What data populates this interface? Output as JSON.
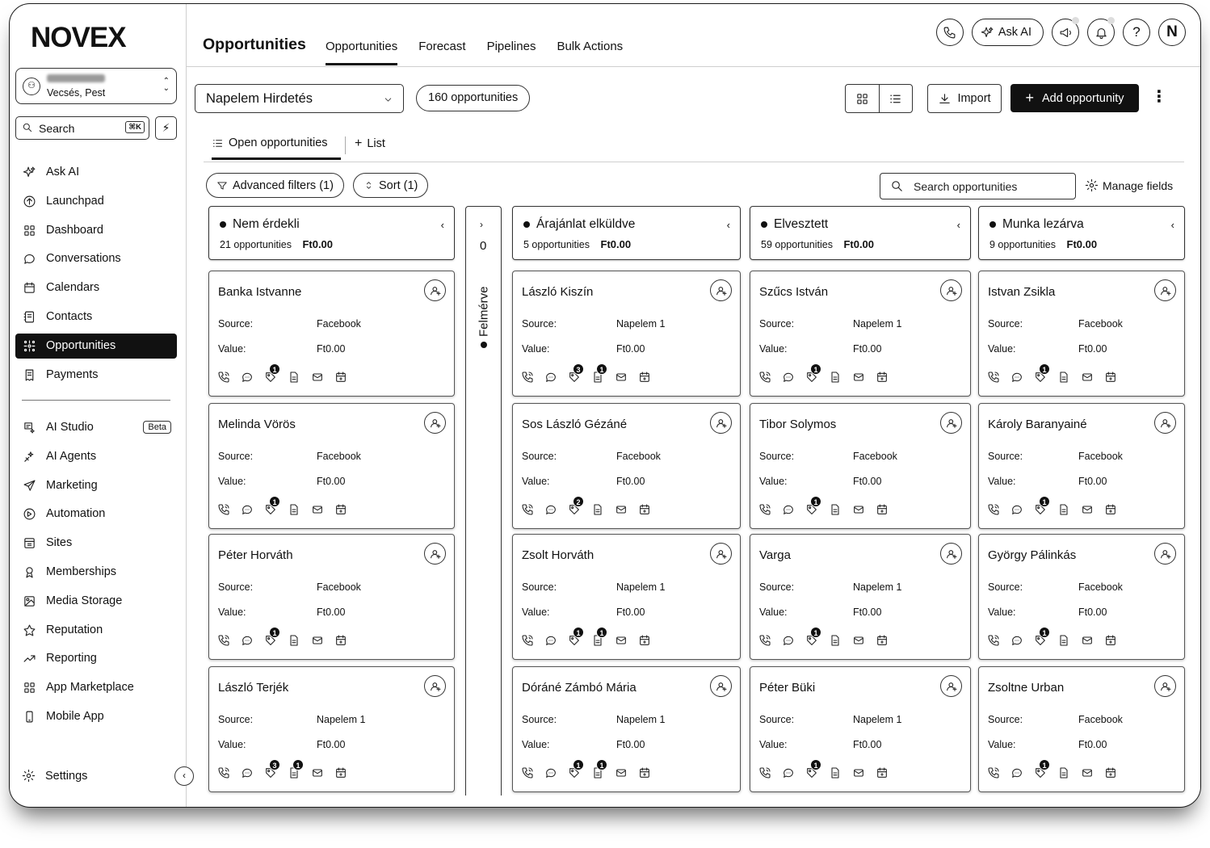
{
  "brand": "NOVEX",
  "location": {
    "city": "Vecsés, Pest"
  },
  "search": {
    "label": "Search",
    "shortcut": "⌘K"
  },
  "nav": [
    {
      "label": "Ask AI",
      "icon": "sparkle-icon"
    },
    {
      "label": "Launchpad",
      "icon": "launchpad-icon"
    },
    {
      "label": "Dashboard",
      "icon": "dashboard-icon"
    },
    {
      "label": "Conversations",
      "icon": "chat-icon"
    },
    {
      "label": "Calendars",
      "icon": "calendar-icon"
    },
    {
      "label": "Contacts",
      "icon": "contacts-icon"
    },
    {
      "label": "Opportunities",
      "icon": "opportunities-icon",
      "active": true
    },
    {
      "label": "Payments",
      "icon": "payments-icon"
    }
  ],
  "nav2": [
    {
      "label": "AI Studio",
      "icon": "ai-studio-icon",
      "badge": "Beta"
    },
    {
      "label": "AI Agents",
      "icon": "ai-agents-icon"
    },
    {
      "label": "Marketing",
      "icon": "send-icon"
    },
    {
      "label": "Automation",
      "icon": "automation-icon"
    },
    {
      "label": "Sites",
      "icon": "sites-icon"
    },
    {
      "label": "Memberships",
      "icon": "membership-icon"
    },
    {
      "label": "Media Storage",
      "icon": "image-icon"
    },
    {
      "label": "Reputation",
      "icon": "star-icon"
    },
    {
      "label": "Reporting",
      "icon": "trend-icon"
    },
    {
      "label": "App Marketplace",
      "icon": "grid-icon"
    },
    {
      "label": "Mobile App",
      "icon": "phone-device-icon"
    }
  ],
  "settings": "Settings",
  "header": {
    "title": "Opportunities",
    "tabs": [
      "Opportunities",
      "Forecast",
      "Pipelines",
      "Bulk Actions"
    ],
    "ask_ai": "Ask AI",
    "avatar": "N"
  },
  "toolbar": {
    "pipeline": "Napelem Hirdetés",
    "count": "160 opportunities",
    "import": "Import",
    "add": "Add opportunity"
  },
  "subtabs": {
    "open": "Open opportunities",
    "list": "List"
  },
  "filters": {
    "advanced": "Advanced filters (1)",
    "sort": "Sort (1)",
    "search_placeholder": "Search opportunities",
    "manage": "Manage fields"
  },
  "labels": {
    "source": "Source:",
    "value": "Value:"
  },
  "collapsed_stage": {
    "name": "Felmérve",
    "count": "0"
  },
  "stages": [
    {
      "name": "Nem érdekli",
      "count": "21 opportunities",
      "total": "Ft0.00",
      "cards": [
        {
          "name": "Banka Istvanne",
          "source": "Facebook",
          "value": "Ft0.00",
          "badges": {
            "shield": "1"
          }
        },
        {
          "name": "Melinda Vörös",
          "source": "Facebook",
          "value": "Ft0.00",
          "badges": {
            "shield": "1"
          }
        },
        {
          "name": "Péter Horváth",
          "source": "Facebook",
          "value": "Ft0.00",
          "badges": {
            "shield": "1"
          }
        },
        {
          "name": "László Terjék",
          "source": "Napelem 1",
          "value": "Ft0.00",
          "badges": {
            "shield": "3",
            "doc": "1"
          }
        }
      ]
    },
    {
      "name": "Árajánlat elküldve",
      "count": "5 opportunities",
      "total": "Ft0.00",
      "cards": [
        {
          "name": "László Kiszín",
          "source": "Napelem 1",
          "value": "Ft0.00",
          "badges": {
            "shield": "3",
            "doc": "1"
          }
        },
        {
          "name": "Sos László Gézáné",
          "source": "Facebook",
          "value": "Ft0.00",
          "badges": {
            "shield": "2"
          }
        },
        {
          "name": "Zsolt Horváth",
          "source": "Napelem 1",
          "value": "Ft0.00",
          "badges": {
            "shield": "1",
            "doc": "1"
          }
        },
        {
          "name": "Dóráné Zámbó Mária",
          "source": "Napelem 1",
          "value": "Ft0.00",
          "badges": {
            "shield": "1",
            "doc": "1"
          }
        }
      ]
    },
    {
      "name": "Elvesztett",
      "count": "59 opportunities",
      "total": "Ft0.00",
      "cards": [
        {
          "name": "Szűcs István",
          "source": "Napelem 1",
          "value": "Ft0.00",
          "badges": {
            "shield": "1"
          }
        },
        {
          "name": "Tibor Solymos",
          "source": "Facebook",
          "value": "Ft0.00",
          "badges": {
            "shield": "1"
          }
        },
        {
          "name": "Varga",
          "source": "Napelem 1",
          "value": "Ft0.00",
          "badges": {
            "shield": "1"
          }
        },
        {
          "name": "Péter Büki",
          "source": "Napelem 1",
          "value": "Ft0.00",
          "badges": {
            "shield": "1"
          }
        }
      ]
    },
    {
      "name": "Munka lezárva",
      "count": "9 opportunities",
      "total": "Ft0.00",
      "cards": [
        {
          "name": "Istvan Zsikla",
          "source": "Facebook",
          "value": "Ft0.00",
          "badges": {
            "shield": "1"
          }
        },
        {
          "name": "Károly Baranyainé",
          "source": "Facebook",
          "value": "Ft0.00",
          "badges": {
            "shield": "1"
          }
        },
        {
          "name": "György Pálinkás",
          "source": "Facebook",
          "value": "Ft0.00",
          "badges": {
            "shield": "1"
          }
        },
        {
          "name": "Zsoltne Urban",
          "source": "Facebook",
          "value": "Ft0.00",
          "badges": {
            "shield": "1"
          }
        }
      ]
    }
  ]
}
